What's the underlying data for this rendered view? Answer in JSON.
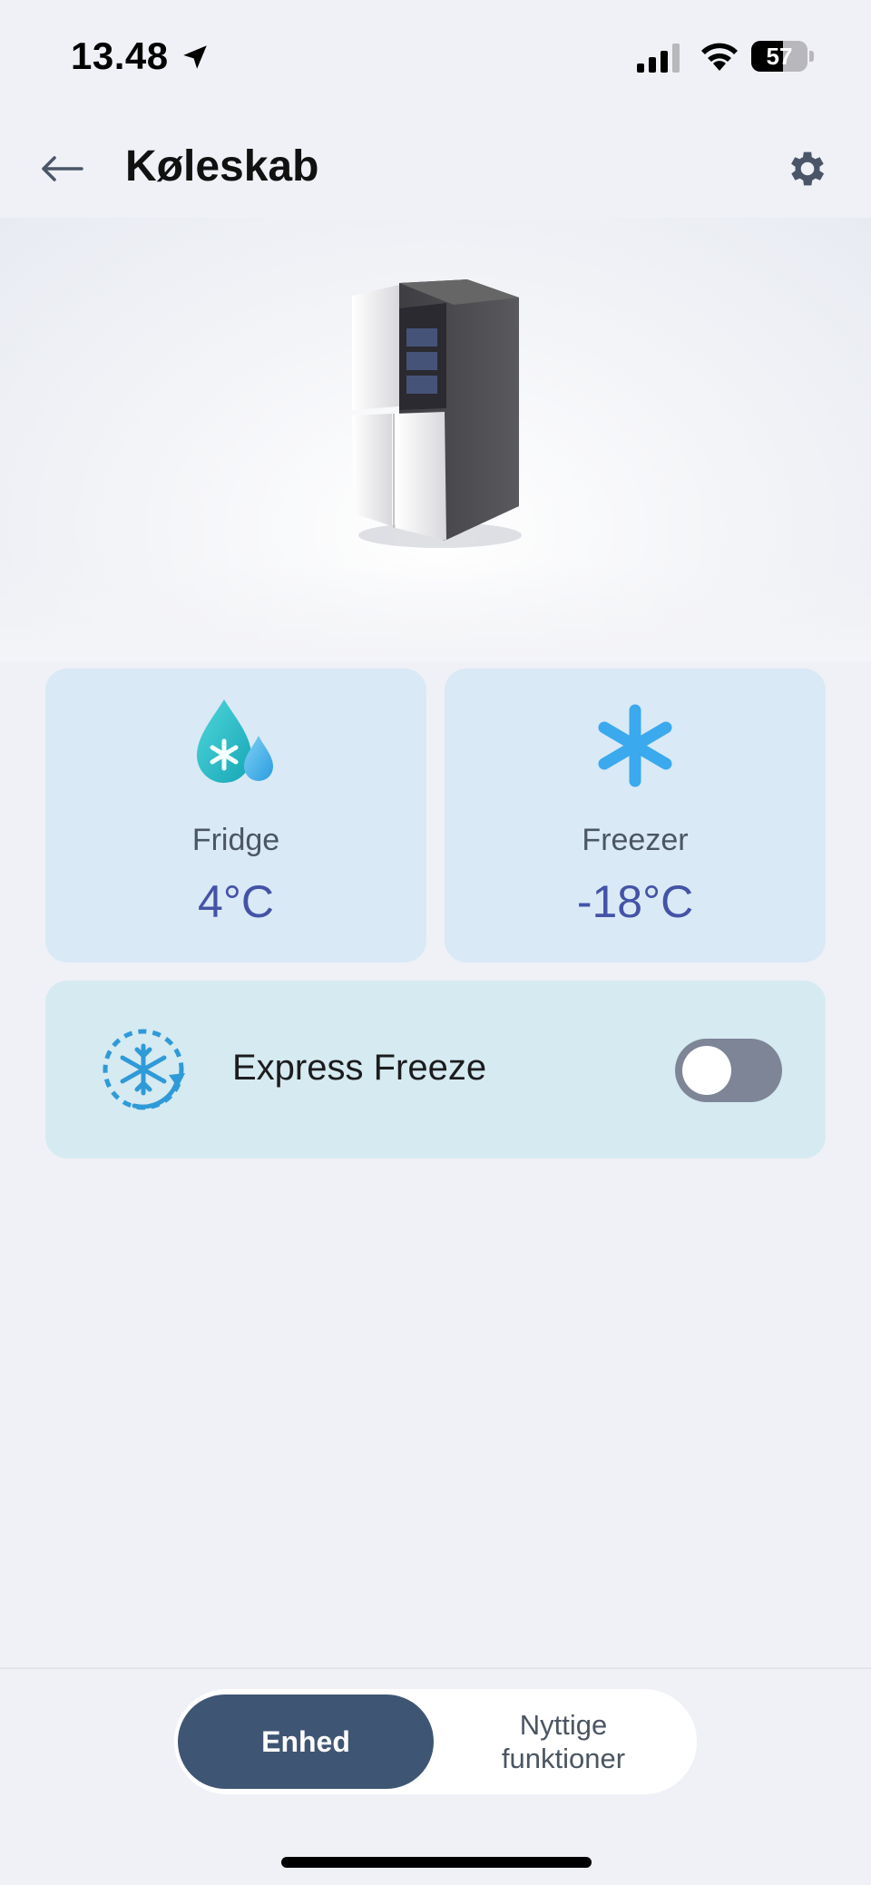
{
  "status_bar": {
    "time": "13.48",
    "battery_percent": 57,
    "battery_label": "57",
    "icons": [
      "location-arrow-icon",
      "cellular-signal-icon",
      "wifi-icon",
      "battery-icon"
    ]
  },
  "header": {
    "title": "Køleskab",
    "back_icon": "arrow-left-icon",
    "settings_icon": "gear-icon"
  },
  "hero": {
    "image": "refrigerator-illustration"
  },
  "tiles": [
    {
      "label": "Fridge",
      "value": "4°C",
      "icon": "water-drop-snowflake-icon"
    },
    {
      "label": "Freezer",
      "value": "-18°C",
      "icon": "snowflake-icon"
    }
  ],
  "express_freeze": {
    "label": "Express Freeze",
    "icon": "express-freeze-icon",
    "enabled": false
  },
  "bottom_tabs": {
    "active": "Enhed",
    "inactive_line1": "Nyttige",
    "inactive_line2": "funktioner"
  },
  "colors": {
    "background": "#eff1f6",
    "tile": "#d9e9f6",
    "express_card": "#d6eaf1",
    "value_text": "#4453a7",
    "active_tab": "#3f5574",
    "toggle_off": "#7d8597"
  }
}
